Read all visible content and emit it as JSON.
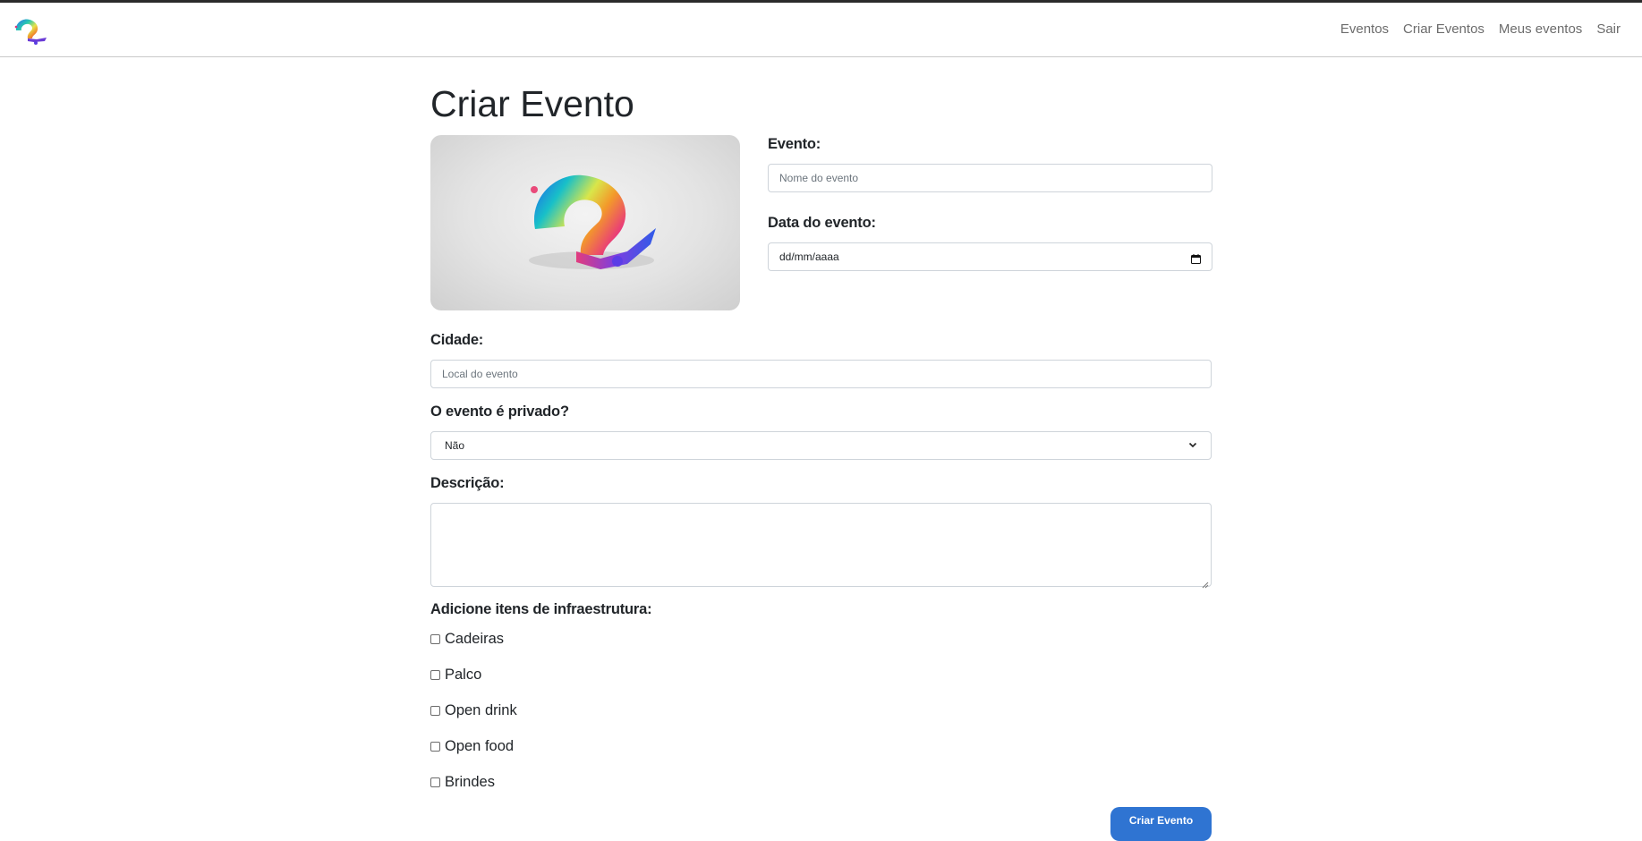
{
  "nav": {
    "links": [
      "Eventos",
      "Criar Eventos",
      "Meus eventos",
      "Sair"
    ]
  },
  "page": {
    "title": "Criar Evento"
  },
  "form": {
    "event_label": "Evento:",
    "event_placeholder": "Nome do evento",
    "date_label": "Data do evento:",
    "date_value": "dd/mm/aaaa",
    "city_label": "Cidade:",
    "city_placeholder": "Local do evento",
    "private_label": "O evento é privado?",
    "private_selected": "Não",
    "description_label": "Descrição:",
    "infra_label": "Adicione itens de infraestrutura:",
    "infra_items": [
      "Cadeiras",
      "Palco",
      "Open drink",
      "Open food",
      "Brindes"
    ],
    "submit_label": "Criar Evento"
  },
  "icons": {
    "brand": "brand-logo",
    "hero": "event-placeholder-image",
    "calendar": "calendar-icon",
    "select": "chevron-down-icon"
  },
  "colors": {
    "accent": "#2f74d2",
    "nav_text": "#6c6c6c",
    "text": "#212529",
    "border": "#ced4da"
  }
}
